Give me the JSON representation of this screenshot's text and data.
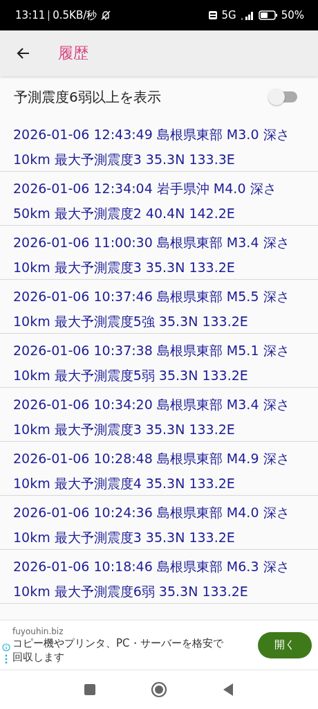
{
  "status_bar": {
    "time": "13:11",
    "speed": "0.5KB/秒",
    "network": "5G",
    "battery": "50%"
  },
  "header": {
    "title": "履歴"
  },
  "filter": {
    "label": "予測震度6弱以上を表示",
    "on": false
  },
  "history": [
    {
      "text": "2026-01-06 12:43:49 島根県東部 M3.0 深さ10km 最大予測震度3 35.3N 133.3E"
    },
    {
      "text": "2026-01-06 12:34:04 岩手県沖 M4.0 深さ50km 最大予測震度2 40.4N 142.2E"
    },
    {
      "text": "2026-01-06 11:00:30 島根県東部 M3.4 深さ10km 最大予測震度3 35.3N 133.2E"
    },
    {
      "text": "2026-01-06 10:37:46 島根県東部 M5.5 深さ10km 最大予測震度5強 35.3N 133.2E"
    },
    {
      "text": "2026-01-06 10:37:38 島根県東部 M5.1 深さ10km 最大予測震度5弱 35.3N 133.2E"
    },
    {
      "text": "2026-01-06 10:34:20 島根県東部 M3.4 深さ10km 最大予測震度3 35.3N 133.2E"
    },
    {
      "text": "2026-01-06 10:28:48 島根県東部 M4.9 深さ10km 最大予測震度4 35.3N 133.2E"
    },
    {
      "text": "2026-01-06 10:24:36 島根県東部 M4.0 深さ10km 最大予測震度3 35.3N 133.2E"
    },
    {
      "text": "2026-01-06 10:18:46 島根県東部 M6.3 深さ10km 最大予測震度6弱 35.3N 133.2E"
    }
  ],
  "ad": {
    "domain": "fuyouhin.biz",
    "text": "コピー機やプリンタ、PC・サーバーを格安で回収します",
    "button": "開く"
  }
}
